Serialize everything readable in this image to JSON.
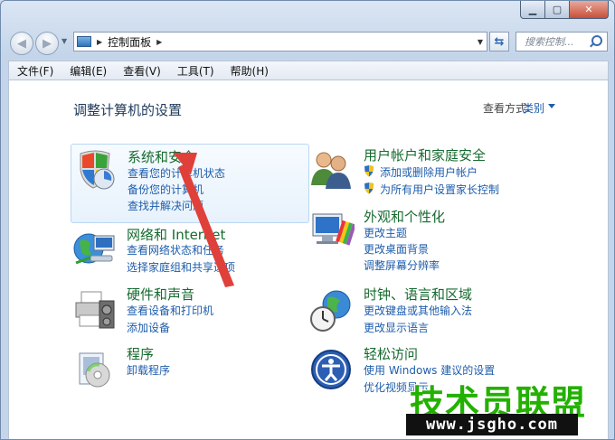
{
  "window": {
    "controls": {
      "minimize": "▁",
      "maximize": "▢",
      "close": "✕"
    }
  },
  "address": {
    "path": "控制面板",
    "search_placeholder": "搜索控制..."
  },
  "menu": [
    "文件(F)",
    "编辑(E)",
    "查看(V)",
    "工具(T)",
    "帮助(H)"
  ],
  "content": {
    "title": "调整计算机的设置",
    "view_by_label": "查看方式:",
    "view_by_value": "类别"
  },
  "categories": [
    {
      "title": "系统和安全",
      "links": [
        "查看您的计算机状态",
        "备份您的计算机",
        "查找并解决问题"
      ],
      "icon": "shield-icon"
    },
    {
      "title": "网络和 Internet",
      "links": [
        "查看网络状态和任务",
        "选择家庭组和共享选项"
      ],
      "icon": "network-icon"
    },
    {
      "title": "硬件和声音",
      "links": [
        "查看设备和打印机",
        "添加设备"
      ],
      "icon": "printer-icon"
    },
    {
      "title": "程序",
      "links": [
        "卸载程序"
      ],
      "icon": "programs-icon"
    },
    {
      "title": "用户帐户和家庭安全",
      "links": [
        "添加或删除用户帐户",
        "为所有用户设置家长控制"
      ],
      "icon": "users-icon"
    },
    {
      "title": "外观和个性化",
      "links": [
        "更改主题",
        "更改桌面背景",
        "调整屏幕分辨率"
      ],
      "icon": "monitor-icon"
    },
    {
      "title": "时钟、语言和区域",
      "links": [
        "更改键盘或其他输入法",
        "更改显示语言"
      ],
      "icon": "clock-globe-icon"
    },
    {
      "title": "轻松访问",
      "links": [
        "使用 Windows 建议的设置",
        "优化视频显示"
      ],
      "icon": "ease-of-access-icon"
    }
  ],
  "watermark": {
    "text": "技术员联盟",
    "url": "www.jsgho.com"
  },
  "colors": {
    "link": "#1e5dab",
    "category_title": "#166a2f",
    "arrow": "#e0403a",
    "watermark": "#23b100"
  }
}
